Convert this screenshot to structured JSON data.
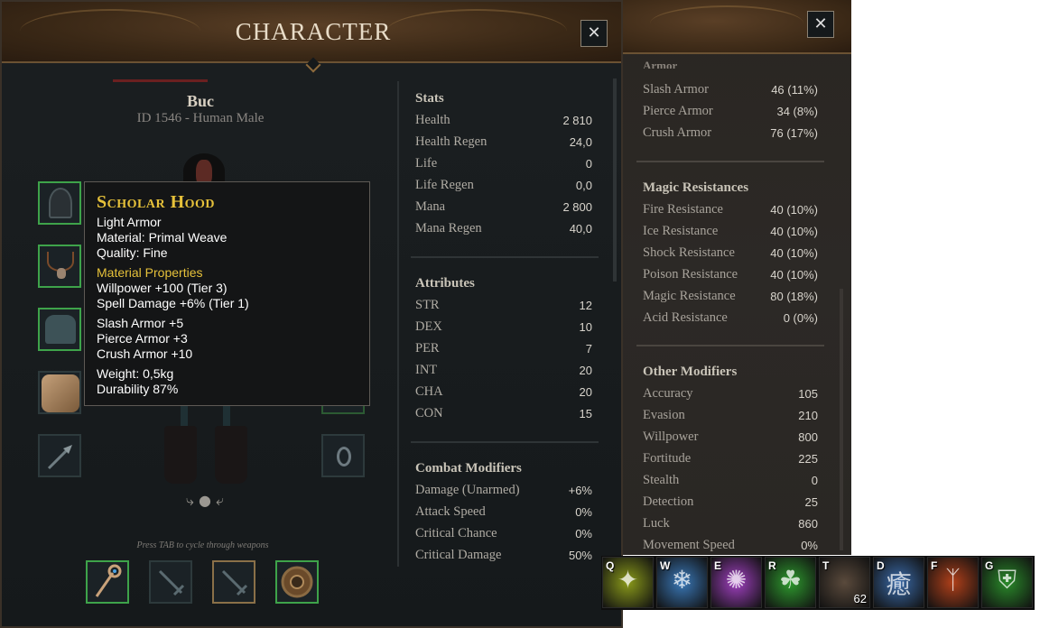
{
  "window": {
    "title": "CHARACTER",
    "close_glyph": "✕"
  },
  "character": {
    "name": "Buc",
    "id_line": "ID 1546 - Human Male"
  },
  "equipment": {
    "left_slots": [
      "hood",
      "necklace",
      "chest-armor",
      "mount",
      "arrows"
    ],
    "right_slots": [
      "empty",
      "empty",
      "empty",
      "empty",
      "ring"
    ],
    "cycle_icon": "⤷ ● ⤶",
    "tab_hint": "Press TAB to cycle through weapons",
    "weapons": [
      "staff",
      "sword",
      "sword",
      "shield"
    ]
  },
  "tooltip": {
    "title": "Scholar Hood",
    "type": "Light Armor",
    "material": "Material: Primal Weave",
    "quality": "Quality: Fine",
    "material_props_header": "Material Properties",
    "prop1": "Willpower +100 (Tier 3)",
    "prop2": "Spell Damage +6% (Tier 1)",
    "slash": "Slash Armor +5",
    "pierce": "Pierce Armor +3",
    "crush": "Crush Armor +10",
    "weight": "Weight: 0,5kg",
    "durability": "Durability 87%"
  },
  "stats": {
    "title": "Stats",
    "rows": [
      {
        "label": "Health",
        "value": "2 810"
      },
      {
        "label": "Health Regen",
        "value": "24,0"
      },
      {
        "label": "Life",
        "value": "0"
      },
      {
        "label": "Life Regen",
        "value": "0,0"
      },
      {
        "label": "Mana",
        "value": "2 800"
      },
      {
        "label": "Mana Regen",
        "value": "40,0"
      }
    ]
  },
  "attributes": {
    "title": "Attributes",
    "rows": [
      {
        "label": "STR",
        "value": "12"
      },
      {
        "label": "DEX",
        "value": "10"
      },
      {
        "label": "PER",
        "value": "7"
      },
      {
        "label": "INT",
        "value": "20"
      },
      {
        "label": "CHA",
        "value": "20"
      },
      {
        "label": "CON",
        "value": "15"
      }
    ]
  },
  "combat": {
    "title": "Combat Modifiers",
    "rows": [
      {
        "label": "Damage (Unarmed)",
        "value": "+6%"
      },
      {
        "label": "Attack Speed",
        "value": "0%"
      },
      {
        "label": "Critical Chance",
        "value": "0%"
      },
      {
        "label": "Critical Damage",
        "value": "50%"
      }
    ]
  },
  "armor": {
    "title_cut": "Armor",
    "rows": [
      {
        "label": "Slash Armor",
        "value": "46 (11%)"
      },
      {
        "label": "Pierce Armor",
        "value": "34 (8%)"
      },
      {
        "label": "Crush Armor",
        "value": "76 (17%)"
      }
    ]
  },
  "magic_res": {
    "title": "Magic Resistances",
    "rows": [
      {
        "label": "Fire Resistance",
        "value": "40 (10%)"
      },
      {
        "label": "Ice Resistance",
        "value": "40 (10%)"
      },
      {
        "label": "Shock Resistance",
        "value": "40 (10%)"
      },
      {
        "label": "Poison Resistance",
        "value": "40 (10%)"
      },
      {
        "label": "Magic Resistance",
        "value": "80 (18%)"
      },
      {
        "label": "Acid Resistance",
        "value": "0 (0%)"
      }
    ]
  },
  "other": {
    "title": "Other Modifiers",
    "rows": [
      {
        "label": "Accuracy",
        "value": "105"
      },
      {
        "label": "Evasion",
        "value": "210"
      },
      {
        "label": "Willpower",
        "value": "800"
      },
      {
        "label": "Fortitude",
        "value": "225"
      },
      {
        "label": "Stealth",
        "value": "0"
      },
      {
        "label": "Detection",
        "value": "25"
      },
      {
        "label": "Luck",
        "value": "860"
      },
      {
        "label": "Movement Speed",
        "value": "0%"
      }
    ]
  },
  "hotbar": [
    {
      "key": "Q",
      "icon": "spark-icon",
      "glyph": "✦",
      "color": "#8a9a1a",
      "count": ""
    },
    {
      "key": "W",
      "icon": "ice-crystal-icon",
      "glyph": "❄",
      "color": "#3a78b8",
      "count": ""
    },
    {
      "key": "E",
      "icon": "arcane-burst-icon",
      "glyph": "✺",
      "color": "#a040c0",
      "count": ""
    },
    {
      "key": "R",
      "icon": "nature-rune-icon",
      "glyph": "☘",
      "color": "#2e9a2e",
      "count": ""
    },
    {
      "key": "T",
      "icon": "bandage-icon",
      "glyph": "",
      "color": "#5a4a3c",
      "count": "62"
    },
    {
      "key": "D",
      "icon": "heal-rune-icon",
      "glyph": "癒",
      "color": "#3a6aa8",
      "count": ""
    },
    {
      "key": "F",
      "icon": "fire-rune-icon",
      "glyph": "ᛉ",
      "color": "#b0401a",
      "count": ""
    },
    {
      "key": "G",
      "icon": "shield-buff-icon",
      "glyph": "⛨",
      "color": "#2a8a2a",
      "count": ""
    }
  ]
}
